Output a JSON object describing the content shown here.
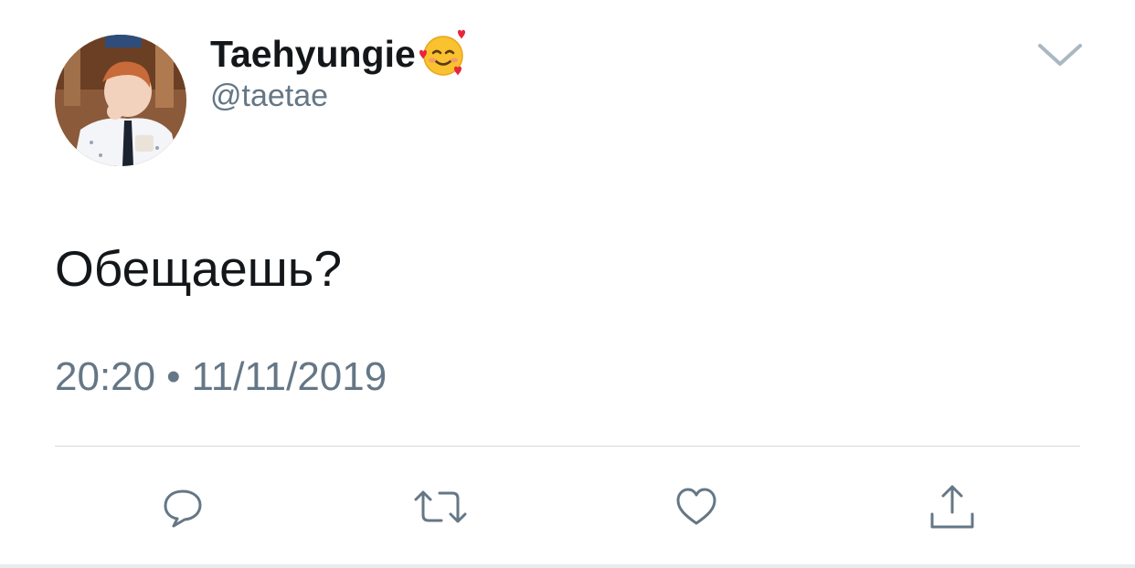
{
  "tweet": {
    "display_name": "Taehyungie",
    "handle": "@taetae",
    "text": "Обещаешь?",
    "time": "20:20",
    "separator": "•",
    "date": "11/11/2019"
  },
  "icons": {
    "avatar": "profile-photo",
    "name_emoji": "smiling-face-with-hearts-emoji",
    "menu": "chevron-down-icon",
    "reply": "reply-icon",
    "retweet": "retweet-icon",
    "like": "heart-icon",
    "share": "share-icon"
  },
  "colors": {
    "text_primary": "#14171a",
    "text_secondary": "#657786",
    "icon_gray": "#657786",
    "chevron_gray": "#aab8c2",
    "divider": "#d4dade"
  }
}
